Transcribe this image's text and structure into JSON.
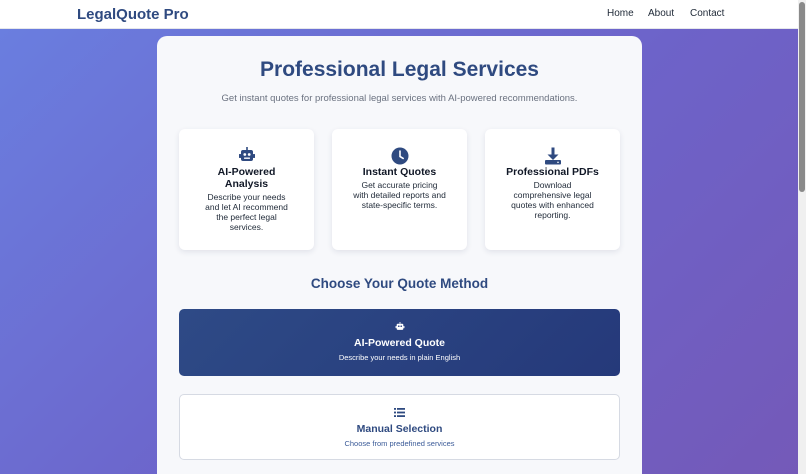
{
  "nav": {
    "brand": "LegalQuote Pro",
    "links": [
      "Home",
      "About",
      "Contact"
    ]
  },
  "hero": {
    "title": "Professional Legal Services",
    "subtitle": "Get instant quotes for professional legal services with AI-powered recommendations."
  },
  "features": [
    {
      "icon": "robot-icon",
      "title_lines": [
        "AI-Powered",
        "Analysis"
      ],
      "desc_lines": [
        "Describe your needs",
        "and let AI recommend",
        "the perfect legal",
        "services."
      ]
    },
    {
      "icon": "clock-icon",
      "title_lines": [
        "Instant Quotes"
      ],
      "desc_lines": [
        "Get accurate pricing",
        "with detailed reports and",
        "state-specific terms."
      ]
    },
    {
      "icon": "download-icon",
      "title_lines": [
        "Professional PDFs"
      ],
      "desc_lines": [
        "Download",
        "comprehensive legal",
        "quotes with enhanced",
        "reporting."
      ]
    }
  ],
  "quote_methods": {
    "title": "Choose Your Quote Method",
    "ai": {
      "icon": "robot-icon",
      "title": "AI-Powered Quote",
      "desc": "Describe your needs in plain English"
    },
    "manual": {
      "icon": "list-icon",
      "title": "Manual Selection",
      "desc": "Choose from predefined services"
    }
  },
  "colors": {
    "brand": "#2f4a80",
    "accent_button": "#2a4282",
    "background_gradient_start": "#6a7fe0",
    "background_gradient_end": "#7459b8"
  }
}
